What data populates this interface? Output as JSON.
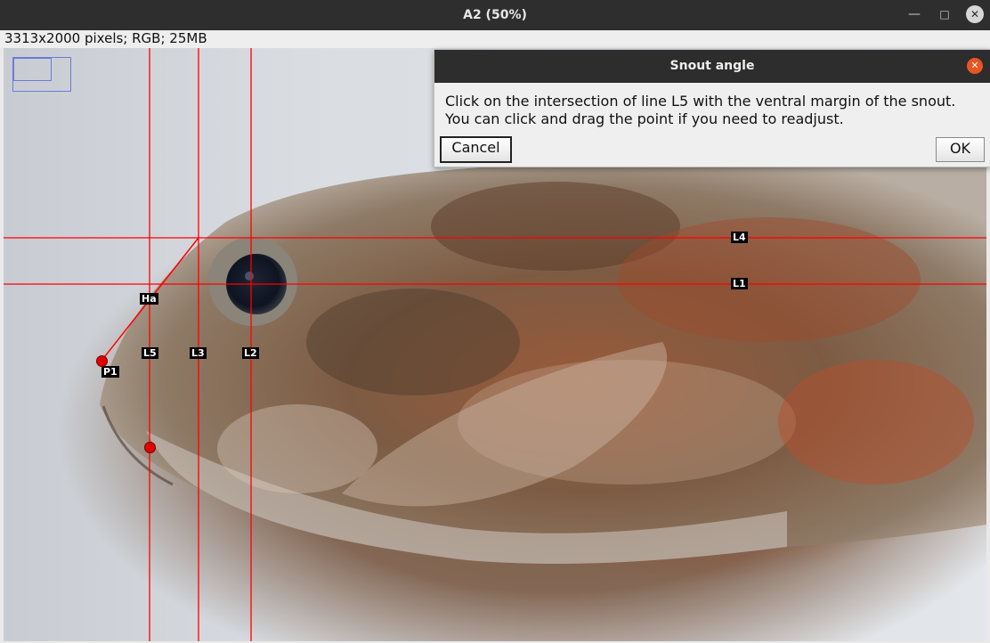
{
  "window": {
    "title": "A2 (50%)",
    "minimize_icon": "minimize-icon",
    "maximize_icon": "maximize-icon",
    "close_icon": "close-icon"
  },
  "image_info": "3313x2000 pixels; RGB; 25MB",
  "overlay": {
    "line_color": "#ff0000",
    "labels": {
      "l4": "L4",
      "l1": "L1",
      "ha": "Ha",
      "l5": "L5",
      "l3": "L3",
      "l2": "L2",
      "p1": "P1"
    }
  },
  "dialog": {
    "title": "Snout angle",
    "message_line1": "Click on the intersection of line L5 with the ventral margin of the snout.",
    "message_line2": "You can click and drag the point if you need to readjust.",
    "cancel_label": "Cancel",
    "ok_label": "OK",
    "close_icon": "close-icon",
    "accent_color": "#e95420"
  }
}
